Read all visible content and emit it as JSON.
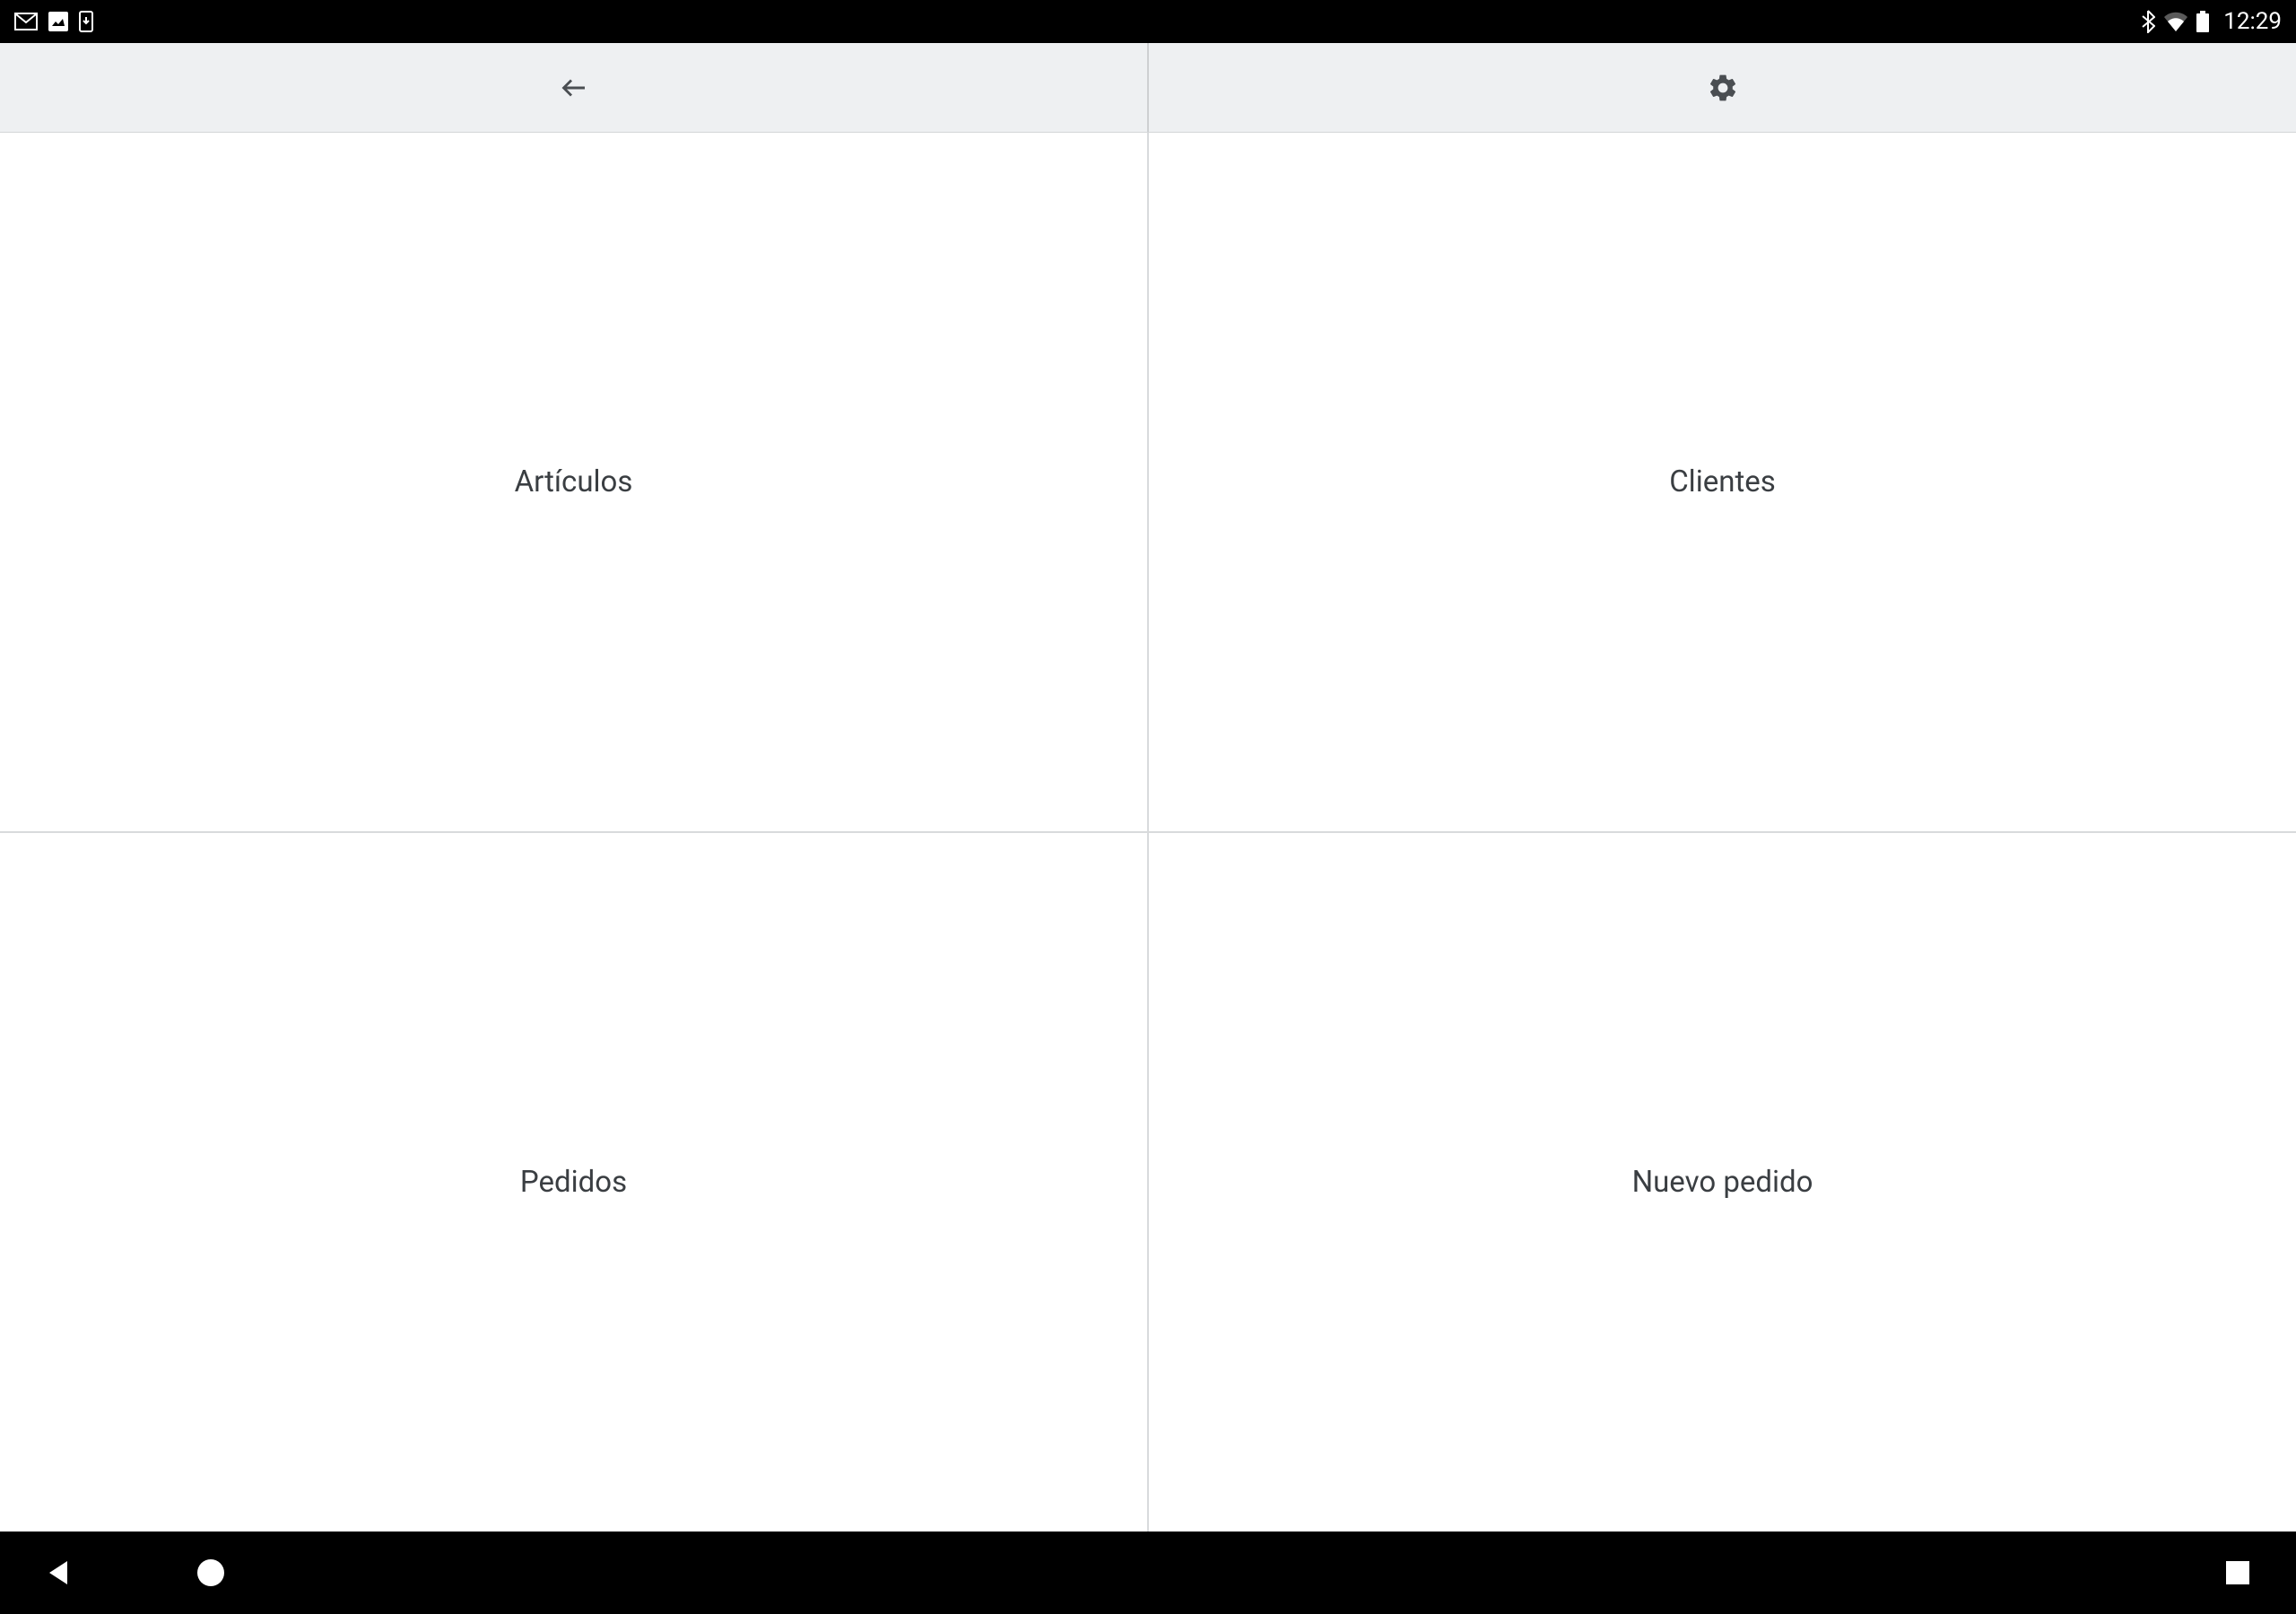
{
  "status_bar": {
    "time": "12:29"
  },
  "tiles": [
    {
      "label": "Artículos"
    },
    {
      "label": "Clientes"
    },
    {
      "label": "Pedidos"
    },
    {
      "label": "Nuevo pedido"
    }
  ]
}
